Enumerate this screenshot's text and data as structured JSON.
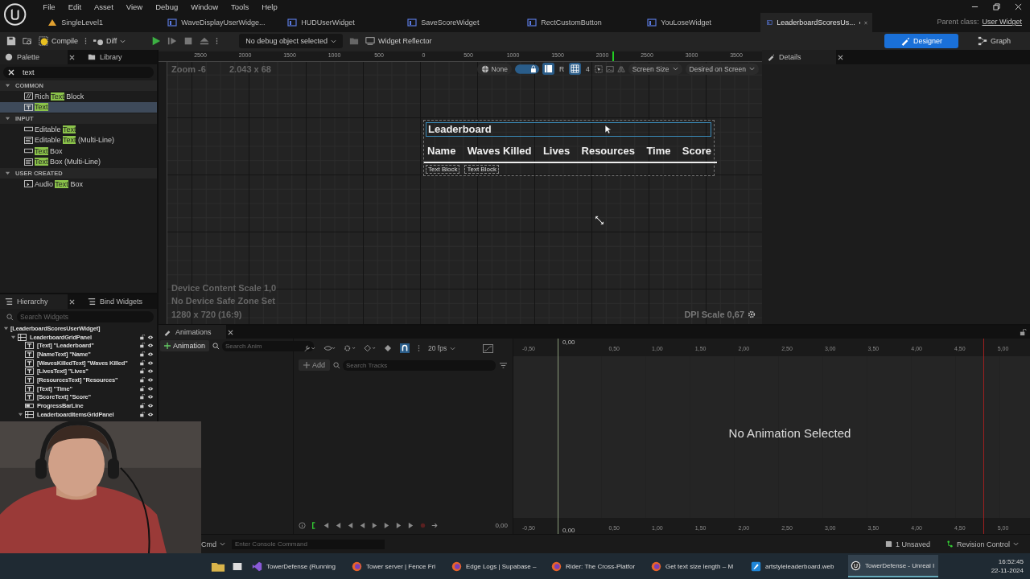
{
  "menu": [
    "File",
    "Edit",
    "Asset",
    "View",
    "Debug",
    "Window",
    "Tools",
    "Help"
  ],
  "tabs": [
    {
      "label": "SingleLevel1",
      "kind": "level",
      "selected": false,
      "modified": false
    },
    {
      "label": "WaveDisplayUserWidge...",
      "kind": "widget",
      "selected": false,
      "modified": false
    },
    {
      "label": "HUDUserWidget",
      "kind": "widget",
      "selected": false,
      "modified": false
    },
    {
      "label": "SaveScoreWidget",
      "kind": "widget",
      "selected": false,
      "modified": false
    },
    {
      "label": "RectCustomButton",
      "kind": "widget",
      "selected": false,
      "modified": false
    },
    {
      "label": "YouLoseWidget",
      "kind": "widget",
      "selected": false,
      "modified": false
    },
    {
      "label": "LeaderboardScoresUs...",
      "kind": "widget",
      "selected": true,
      "modified": true
    }
  ],
  "parent_class": {
    "label": "Parent class:",
    "value": "User Widget"
  },
  "toolbar": {
    "compile": "Compile",
    "diff": "Diff",
    "debug_select": "No debug object selected",
    "reflector": "Widget Reflector"
  },
  "modes": [
    {
      "label": "Designer",
      "kind": "designer",
      "selected": true
    },
    {
      "label": "Graph",
      "kind": "graph",
      "selected": false
    }
  ],
  "palette": {
    "tabs": [
      "Palette",
      "Library"
    ],
    "search": "text",
    "sections": [
      {
        "title": "COMMON",
        "expanded": true,
        "items": [
          {
            "kind": "rich",
            "before": "Rich ",
            "match": "Text",
            "after": " Block",
            "selected": false
          },
          {
            "kind": "text",
            "match": "Text",
            "selected": true
          }
        ]
      },
      {
        "title": "INPUT",
        "expanded": true,
        "items": [
          {
            "kind": "editable",
            "before": "Editable ",
            "match": "Text",
            "selected": false
          },
          {
            "kind": "multiline",
            "before": "Editable ",
            "match": "Text",
            "after": " (Multi-Line)",
            "selected": false
          },
          {
            "kind": "editable",
            "match": "Text",
            "after": " Box",
            "selected": false
          },
          {
            "kind": "multiline",
            "match": "Text",
            "after": " Box (Multi-Line)",
            "selected": false
          }
        ]
      },
      {
        "title": "USER CREATED",
        "expanded": true,
        "items": [
          {
            "kind": "audio",
            "before": "Audio ",
            "match": "Text",
            "after": " Box",
            "selected": false
          }
        ]
      }
    ]
  },
  "hierarchy": {
    "tabs": [
      "Hierarchy",
      "Bind Widgets"
    ],
    "search_placeholder": "Search Widgets",
    "tree": [
      {
        "label": "[LeaderboardScoresUserWidget]",
        "kind": "root",
        "expanded": true,
        "children": [
          {
            "label": "LeaderboardGridPanel",
            "kind": "panel",
            "expanded": true,
            "children": [
              {
                "label": "[Text] \"Leaderboard\"",
                "kind": "text"
              },
              {
                "label": "[NameText] \"Name\"",
                "kind": "text"
              },
              {
                "label": "[WavesKilledText] \"Waves Killed\"",
                "kind": "text"
              },
              {
                "label": "[LivesText] \"Lives\"",
                "kind": "text"
              },
              {
                "label": "[ResourcesText] \"Resources\"",
                "kind": "text"
              },
              {
                "label": "[Text] \"Time\"",
                "kind": "text"
              },
              {
                "label": "[ScoreText] \"Score\"",
                "kind": "text"
              },
              {
                "label": "ProgressBarLine",
                "kind": "bar"
              },
              {
                "label": "LeaderboardItemsGridPanel",
                "kind": "panel",
                "expanded": true
              }
            ]
          }
        ]
      }
    ]
  },
  "canvas": {
    "ruler": [
      "2500",
      "2000",
      "1500",
      "1000",
      "500",
      "0",
      "500",
      "1000",
      "1500",
      "2000",
      "2500",
      "3000",
      "3500"
    ],
    "zoom": "Zoom -6",
    "size": "2.043 x 68",
    "controls": {
      "locale": "None",
      "r": "R",
      "grid": "4",
      "screen": "Screen Size",
      "fill": "Desired on Screen"
    },
    "info": [
      "Device Content Scale 1,0",
      "No Device Safe Zone Set",
      "1280 x 720 (16:9)"
    ],
    "dpi": "DPI Scale 0,67",
    "preview": {
      "title": "Leaderboard",
      "columns": [
        "Name",
        "Waves Killed",
        "Lives",
        "Resources",
        "Time",
        "Score"
      ],
      "placeholders": [
        "Text Block",
        "Text Block"
      ]
    }
  },
  "details": {
    "title": "Details"
  },
  "animations": {
    "tab": "Animations",
    "add_animation": "Animation",
    "search_placeholder": "Search Anim",
    "fps": "20 fps",
    "add_track": "Add",
    "track_search_placeholder": "Search Tracks",
    "top_ticks": [
      "-0,50",
      "0,50",
      "1,00",
      "1,50",
      "2,00",
      "2,50",
      "3,00",
      "3,50",
      "4,00",
      "4,50",
      "5,00"
    ],
    "bottom_ticks": [
      "-0,50",
      "0,50",
      "1,00",
      "1,50",
      "2,00",
      "2,50",
      "3,00",
      "3,50",
      "4,00",
      "4,50",
      "5,00"
    ],
    "playhead": "0,00",
    "end_time": "0,00",
    "message": "No Animation Selected",
    "time": "0,00"
  },
  "status": {
    "cmd": "Cmd",
    "console_placeholder": "Enter Console Command",
    "unsaved": "1 Unsaved",
    "revision": "Revision Control"
  },
  "taskbar": {
    "items": [
      {
        "label": "TowerDefense (Running",
        "kind": "vs",
        "selected": false
      },
      {
        "label": "Tower server | Fence Fri",
        "kind": "firefox",
        "selected": false
      },
      {
        "label": "Edge Logs | Supabase –",
        "kind": "firefox",
        "selected": false
      },
      {
        "label": "Rider: The Cross-Platfor",
        "kind": "firefox",
        "selected": false
      },
      {
        "label": "Get text size length – M",
        "kind": "firefox",
        "selected": false
      },
      {
        "label": "artstyleleaderboard.web",
        "kind": "paint",
        "selected": false
      },
      {
        "label": "TowerDefense - Unreal I",
        "kind": "unreal",
        "selected": true
      }
    ],
    "time": "16:52:45",
    "date": "22-11-2024"
  }
}
